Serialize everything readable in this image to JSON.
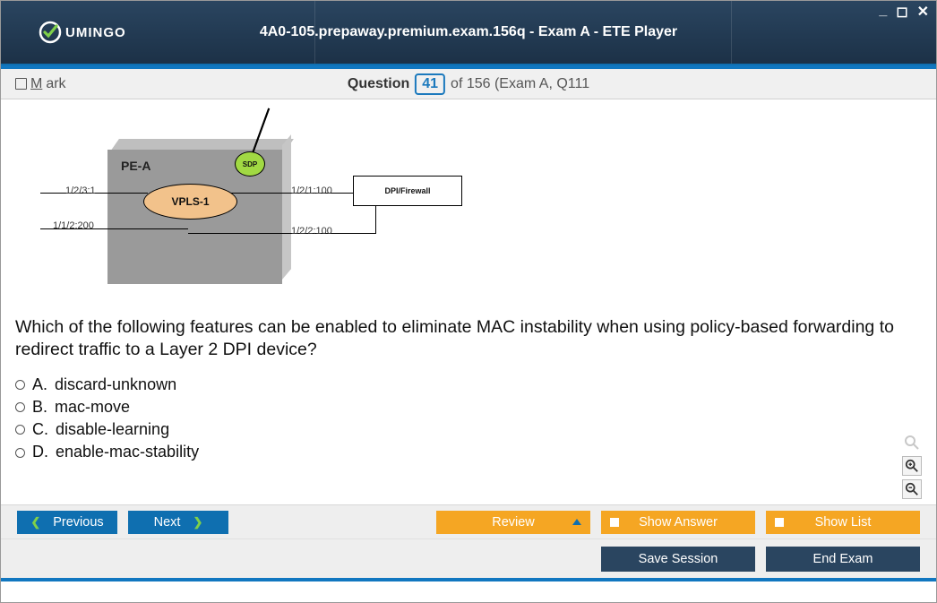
{
  "window": {
    "title": "4A0-105.prepaway.premium.exam.156q - Exam A - ETE Player",
    "logo_text": "UMINGO"
  },
  "header": {
    "mark_label": "Mark",
    "question_label": "Question",
    "question_number": "41",
    "of_text": "of 156 (Exam A, Q111"
  },
  "diagram": {
    "device": "PE-A",
    "vpls": "VPLS-1",
    "sdp": "SDP",
    "ports": {
      "p1": "1/2/3:1",
      "p2": "1/1/2:200",
      "p3": "1/2/1:100",
      "p4": "1/2/2:100"
    },
    "dpi": "DPI/Firewall"
  },
  "question": "Which of the following features can be enabled to eliminate MAC instability when using policy-based forwarding to redirect traffic to a Layer 2 DPI device?",
  "options": [
    {
      "letter": "A.",
      "text": "discard-unknown"
    },
    {
      "letter": "B.",
      "text": "mac-move"
    },
    {
      "letter": "C.",
      "text": "disable-learning"
    },
    {
      "letter": "D.",
      "text": "enable-mac-stability"
    }
  ],
  "buttons": {
    "previous": "Previous",
    "next": "Next",
    "review": "Review",
    "show_answer": "Show Answer",
    "show_list": "Show List",
    "save_session": "Save Session",
    "end_exam": "End Exam"
  }
}
